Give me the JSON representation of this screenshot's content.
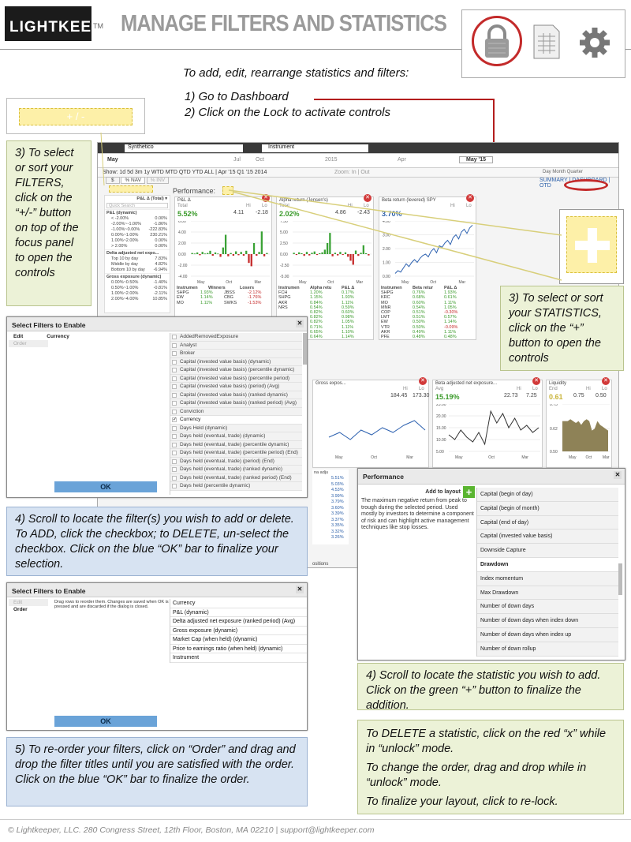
{
  "header": {
    "logo": "LIGHTKEEPER",
    "tm": "TM",
    "title": "MANAGE FILTERS AND STATISTICS",
    "icons": [
      "lock-icon",
      "spreadsheet-icon",
      "gear-icon"
    ]
  },
  "intro": {
    "line": "To add, edit, rearrange statistics and filters:",
    "step1": "1)  Go to Dashboard",
    "step2": "2)  Click on the Lock to activate controls"
  },
  "app": {
    "synthetico": "Synthetico",
    "instrument": "Instrument",
    "may": "May",
    "may15": "May '15",
    "years": [
      "Jul",
      "Oct",
      "2015",
      "Apr"
    ],
    "show_row": "Show:  1d  5d  3m  1y  WTD MTD QTD YTD ALL | Apr '15 Q1 '15 2014",
    "zoom": "Zoom: In | Out",
    "nav_tabs": "SUMMARY | DASHBOARD | OTD",
    "period_tabs": "Day Month Quarter",
    "dollar": "$",
    "pnav": "% NAV",
    "pinv": "% INV",
    "performance": "Performance:",
    "plusminus": "+ / -",
    "pl_total": "P&L Δ (Total) ▾",
    "quick_search": "Quick Search",
    "left_groups": [
      {
        "title": "P&L (dynamic)",
        "rows": [
          [
            "< -2.00%",
            "0.00%"
          ],
          [
            "-2.00%~-1.00%",
            "-1.86%"
          ],
          [
            "-1.00%~0.00%",
            "-222.83%"
          ],
          [
            "0.00%~1.00%",
            "230.21%"
          ],
          [
            "1.00%~2.00%",
            "0.00%"
          ],
          [
            "> 2.00%",
            "0.00%"
          ]
        ]
      },
      {
        "title": "Delta adjusted net expo...",
        "rows": [
          [
            "Top 10 by day",
            "7.83%"
          ],
          [
            "Middle by day",
            "4.82%"
          ],
          [
            "Bottom 10 by day",
            "-6.94%"
          ]
        ]
      },
      {
        "title": "Gross exposure (dynamic)",
        "rows": [
          [
            "0.00%~0.50%",
            "-1.40%"
          ],
          [
            "0.50%~1.00%",
            "-0.81%"
          ],
          [
            "1.00%~2.00%",
            "-2.11%"
          ],
          [
            "2.00%~4.00%",
            "10.85%"
          ]
        ]
      }
    ],
    "cards": [
      {
        "title": "P&L Δ",
        "sub": "Total",
        "hi": "Hi",
        "lo": "Lo",
        "val": "5.52%",
        "hv": "4.11",
        "lv": "-2.18",
        "yticks": [
          "6.00",
          "4.00",
          "2.00",
          "0.00",
          "-2.00",
          "-4.00"
        ],
        "xticks": [
          "May",
          "Oct",
          "Mar"
        ],
        "cols": [
          "Instrumen",
          "Winners",
          "Losers"
        ],
        "rows": [
          [
            "SHPG",
            "1.93%",
            "JBSS",
            "-2.12%"
          ],
          [
            "EW",
            "1.14%",
            "CBG",
            "-1.76%"
          ],
          [
            "MO",
            "1.11%",
            "SWKS",
            "-1.53%"
          ]
        ]
      },
      {
        "title": "Alpha return (Jensen's)",
        "sub": "Total",
        "hi": "Hi",
        "lo": "Lo",
        "val": "2.02%",
        "hv": "4.86",
        "lv": "-2.43",
        "yticks": [
          "7.50",
          "5.00",
          "2.50",
          "0.00",
          "-2.50",
          "-5.00"
        ],
        "xticks": [
          "May",
          "Oct",
          "Mar"
        ],
        "cols": [
          "Instrumen",
          "Alpha retu",
          "P&L Δ"
        ],
        "rows": [
          [
            "FCH",
            "1.20%",
            "0.17%"
          ],
          [
            "SHPG",
            "1.15%",
            "1.93%"
          ],
          [
            "AKR",
            "0.84%",
            "1.11%"
          ],
          [
            "NRS",
            "0.54%",
            "0.59%"
          ],
          [
            "",
            "0.82%",
            "0.60%"
          ],
          [
            "",
            "0.82%",
            "0.98%"
          ],
          [
            "",
            "0.82%",
            "1.05%"
          ],
          [
            "",
            "0.71%",
            "1.11%"
          ],
          [
            "",
            "0.65%",
            "1.10%"
          ],
          [
            "",
            "0.64%",
            "1.14%"
          ]
        ]
      },
      {
        "title": "Beta return (levered) SPY",
        "sub": "",
        "hi": "Hi",
        "lo": "Lo",
        "val": "3.70%",
        "hv": "",
        "lv": "",
        "yticks": [
          "4.00",
          "3.00",
          "2.00",
          "1.00",
          "0.00"
        ],
        "xticks": [
          "May",
          "Oct",
          "Mar"
        ],
        "cols": [
          "Instrumen",
          "Beta retur",
          "P&L Δ"
        ],
        "rows": [
          [
            "SHPG",
            "0.76%",
            "1.93%"
          ],
          [
            "KRC",
            "0.68%",
            "0.61%"
          ],
          [
            "MO",
            "0.60%",
            "1.11%"
          ],
          [
            "MNR",
            "0.54%",
            "1.05%"
          ],
          [
            "COP",
            "0.51%",
            "-0.30%"
          ],
          [
            "LMT",
            "0.51%",
            "0.57%"
          ],
          [
            "EW",
            "0.50%",
            "1.14%"
          ],
          [
            "VTR",
            "0.50%",
            "-0.09%"
          ],
          [
            "AKR",
            "0.49%",
            "1.11%"
          ],
          [
            "PFE",
            "0.48%",
            "0.48%"
          ]
        ]
      },
      {
        "title": "Gross expos...",
        "sub": "",
        "hi": "Hi",
        "lo": "Lo",
        "val": "",
        "hv": "184.45",
        "lv": "173.30",
        "yticks": [],
        "xticks": [
          "May",
          "Oct",
          "Mar"
        ]
      },
      {
        "title": "Beta adjusted net exposure...",
        "sub": "Avg",
        "hi": "Hi",
        "lo": "Lo",
        "val": "15.19%",
        "hv": "22.73",
        "lv": "7.25",
        "yticks": [
          "25.00",
          "20.00",
          "15.00",
          "10.00",
          "5.00"
        ],
        "xticks": [
          "May",
          "Oct",
          "Mar"
        ]
      },
      {
        "title": "Liquidity",
        "sub": "End",
        "hi": "Hi",
        "lo": "Lo",
        "val": "0.61",
        "hv": "0.75",
        "lv": "0.50",
        "yticks": [
          "0.75",
          "0.62",
          "0.50"
        ],
        "xticks": [
          "May",
          "Oct",
          "Mar"
        ]
      }
    ],
    "lower_left_rows": [
      [
        "DNR",
        "",
        "0.60%"
      ],
      [
        "LMT",
        "",
        "3.39%"
      ],
      [
        "COP",
        "3.39%",
        "-0.30%"
      ],
      [
        "TROW",
        "",
        "-0.21%"
      ]
    ],
    "lower_mid_hdr": "P&L Δ",
    "lower_mid_vals": [
      "5.51%",
      "5.03%",
      "4.53%",
      "3.99%",
      "3.79%",
      "3.60%",
      "3.39%",
      "3.37%",
      "3.35%",
      "3.32%",
      "3.26%"
    ],
    "adj_hdr": "na adju",
    "lower_right": "MNR",
    "positions": "ositions"
  },
  "callout_filters": "3) To select or sort your FILTERS, click on the “+/-” button on top of the focus panel to open the controls",
  "callout_stats": "3) To select or sort your STATISTICS, click on the “+” button to open the controls",
  "dialog1": {
    "title": "Select Filters to Enable",
    "edit": "Edit",
    "order": "Order",
    "currency": "Currency",
    "ok": "OK",
    "items": [
      "AddedRemovedExposure",
      "Analyst",
      "Broker",
      "Capital (invested value basis) (dynamic)",
      "Capital (invested value basis) (percentile dynamic)",
      "Capital (invested value basis) (percentile period) (Avg)",
      "Capital (invested value basis) (period) (Avg)",
      "Capital (invested value basis) (ranked dynamic)",
      "Capital (invested value basis) (ranked period) (Avg)",
      "Conviction",
      "Currency",
      "Days Held (dynamic)",
      "Days held (eventual, trade) (dynamic)",
      "Days held (eventual, trade) (percentile dynamic)",
      "Days held (eventual, trade) (percentile period) (End)",
      "Days held (eventual, trade) (period) (End)",
      "Days held (eventual, trade) (ranked dynamic)",
      "Days held (eventual, trade) (ranked period) (End)",
      "Days held (percentile dynamic)"
    ]
  },
  "step4_filters": "4) Scroll to locate the filter(s) you wish to add or delete. To ADD, click the checkbox; to DELETE, un-select the checkbox.  Click on the blue “OK” bar to finalize your selection.",
  "dialog2": {
    "title": "Select Filters to Enable",
    "edit": "Edit",
    "order": "Order",
    "hint": "Drag rows to reorder them. Changes are saved when OK is pressed and are discarded if the dialog is closed.",
    "ok": "OK",
    "items": [
      "Currency",
      "P&L (dynamic)",
      "Delta adjusted net exposure (ranked period) (Avg)",
      "Gross exposure (dynamic)",
      "Market Cap (when held) (dynamic)",
      "Price to earnings ratio (when held) (dynamic)",
      "Instrument"
    ]
  },
  "step5": "5) To re-order your filters, click on “Order” and drag and drop the filter titles until you are satisfied with the order.  Click on the blue “OK” bar to finalize the order.",
  "perf_dialog": {
    "title": "Performance",
    "add_to_layout": "Add to layout",
    "desc": "The maximum negative return from peak to trough during the selected period. Used mostly by investors to determine a component of risk and can highlight active management techniques like stop losses.",
    "items": [
      "Capital (begin of day)",
      "Capital (begin of month)",
      "Capital (end of day)",
      "Capital (invested value basis)",
      "Downside Capture",
      "Drawdown",
      "Index momentum",
      "Max Drawdown",
      "Number of down days",
      "Number of down days when index down",
      "Number of down days when index up",
      "Number of down rollup"
    ]
  },
  "step4_stats": "4) Scroll to locate the statistic you wish to add.  Click on the green “+” button to finalize the addition.",
  "final_notes": [
    "To DELETE a statistic, click on the red “x” while in “unlock” mode.",
    "To change the order, drag and drop while in “unlock” mode.",
    "To finalize your layout, click to re-lock."
  ],
  "footer": "© Lightkeeper, LLC.  280 Congress Street, 12th Floor, Boston, MA 02210 | support@lightkeeper.com",
  "chart_data": [
    {
      "type": "bar",
      "title": "P&L Δ",
      "values": [
        0.2,
        0.1,
        0.3,
        -0.2,
        0.4,
        0.1,
        0.2,
        0.6,
        -0.3,
        0.3,
        0.1,
        -0.5,
        1.2,
        3.5,
        -0.4,
        0.2,
        -0.3,
        0.5,
        -0.2,
        0.4,
        -0.3,
        0.6,
        -1.6,
        -2.2,
        2.0,
        -0.3,
        0.4,
        4.1,
        -0.4,
        0.2
      ],
      "ylim": [
        -4,
        6
      ]
    },
    {
      "type": "bar",
      "title": "Alpha return (Jensen's)",
      "values": [
        0.3,
        -0.2,
        0.4,
        0.2,
        -0.4,
        0.5,
        -0.3,
        0.3,
        0.6,
        -0.2,
        0.2,
        0.4,
        1.0,
        2.5,
        4.8,
        -0.5,
        0.3,
        -0.3,
        0.5,
        -0.2,
        0.4,
        -0.6,
        -1.5,
        -2.4,
        0.8,
        -0.4,
        0.3,
        2.0,
        0.2,
        -0.3
      ],
      "ylim": [
        -5,
        7.5
      ]
    },
    {
      "type": "line",
      "title": "Beta return (levered) SPY",
      "values": [
        0.2,
        0.4,
        0.3,
        0.6,
        0.9,
        0.7,
        1.0,
        1.2,
        1.0,
        1.3,
        1.5,
        1.6,
        1.4,
        1.8,
        2.0,
        1.7,
        2.2,
        2.1,
        2.4,
        2.6,
        2.3,
        2.8,
        3.0,
        2.7,
        3.2,
        3.4,
        3.1,
        3.5,
        3.7
      ],
      "ylim": [
        0,
        4
      ]
    },
    {
      "type": "line",
      "title": "Gross expos...",
      "values": [
        176,
        178,
        175,
        179,
        177,
        180,
        178,
        181,
        183,
        179
      ],
      "ylim": [
        170,
        190
      ]
    },
    {
      "type": "line",
      "title": "Beta adjusted net exposure...",
      "values": [
        12,
        10,
        14,
        11,
        9,
        13,
        8,
        22,
        17,
        21,
        15,
        19,
        14,
        16,
        13,
        15
      ],
      "ylim": [
        5,
        25
      ]
    },
    {
      "type": "area",
      "title": "Liquidity",
      "values": [
        0.66,
        0.66,
        0.66,
        0.67,
        0.66,
        0.65,
        0.66,
        0.64,
        0.66,
        0.67,
        0.66,
        0.61,
        0.62,
        0.66,
        0.64,
        0.63,
        0.62,
        0.61
      ],
      "ylim": [
        0.5,
        0.75
      ]
    }
  ]
}
